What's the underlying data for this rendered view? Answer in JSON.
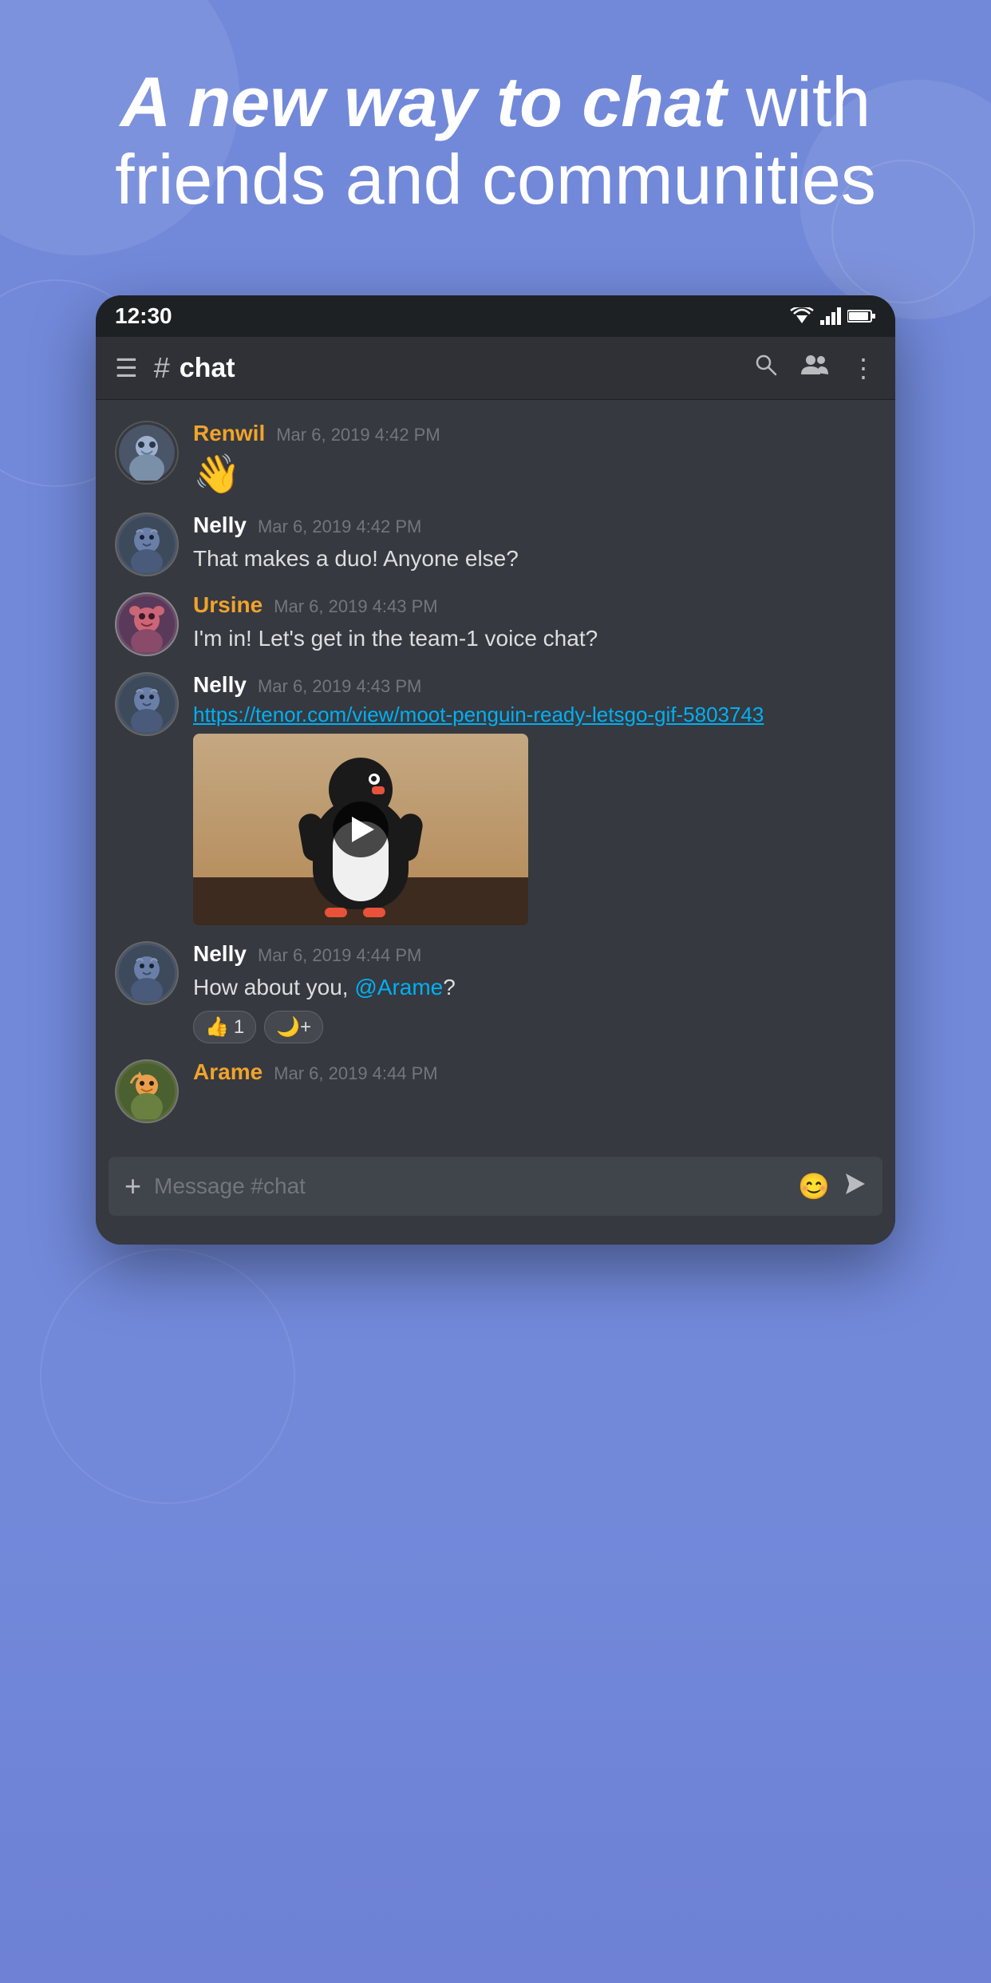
{
  "background": {
    "color": "#7289da"
  },
  "hero": {
    "line1_bold": "A new way to chat",
    "line1_regular": " with",
    "line2": "friends and communities"
  },
  "statusBar": {
    "time": "12:30",
    "wifiIcon": "wifi",
    "signalIcon": "signal",
    "batteryIcon": "battery"
  },
  "toolbar": {
    "menuIcon": "hamburger-menu",
    "hashSymbol": "#",
    "channelName": "chat",
    "searchIcon": "search",
    "membersIcon": "members",
    "moreIcon": "more-vertical"
  },
  "messages": [
    {
      "id": "msg1",
      "user": "Renwil",
      "userColor": "orange",
      "timestamp": "Mar 6, 2019 4:42 PM",
      "content": "👋",
      "type": "emoji"
    },
    {
      "id": "msg2",
      "user": "Nelly",
      "userColor": "white",
      "timestamp": "Mar 6, 2019 4:42 PM",
      "content": "That makes a duo! Anyone else?",
      "type": "text"
    },
    {
      "id": "msg3",
      "user": "Ursine",
      "userColor": "orange",
      "timestamp": "Mar 6, 2019 4:43 PM",
      "content": "I'm in! Let's get in the team-1 voice chat?",
      "type": "text"
    },
    {
      "id": "msg4",
      "user": "Nelly",
      "userColor": "white",
      "timestamp": "Mar 6, 2019 4:43 PM",
      "link": "https://tenor.com/view/moot-penguin-ready-letsgo-gif-5803743",
      "type": "link-video"
    },
    {
      "id": "msg5",
      "user": "Nelly",
      "userColor": "white",
      "timestamp": "Mar 6, 2019 4:44 PM",
      "content": "How about you, @Arame?",
      "mentionText": "@Arame",
      "type": "text-mention",
      "reactions": [
        {
          "emoji": "👍",
          "count": "1"
        },
        {
          "emoji": "🌙+",
          "count": ""
        }
      ]
    },
    {
      "id": "msg6",
      "user": "Arame",
      "userColor": "orange",
      "timestamp": "Mar 6, 2019 4:44 PM",
      "content": "",
      "type": "text"
    }
  ],
  "inputBar": {
    "plusIcon": "+",
    "placeholder": "Message #chat",
    "emojiIcon": "😊",
    "sendIcon": "▶"
  }
}
